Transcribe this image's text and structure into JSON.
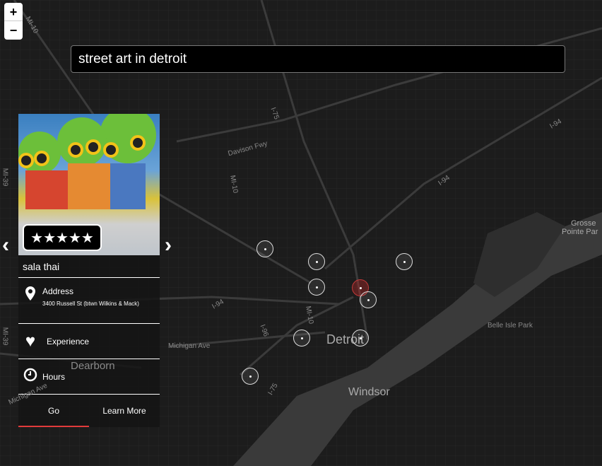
{
  "search": {
    "value": "street art in detroit"
  },
  "zoom": {
    "in": "+",
    "out": "−"
  },
  "card": {
    "rating": "★★★★★",
    "name": "sala thai",
    "address_label": "Address",
    "address": "3400 Russell St (btwn Wilkins & Mack)",
    "experience": "Experience",
    "hours": "Hours",
    "go": "Go",
    "learn_more": "Learn More",
    "prev": "‹",
    "next": "›"
  },
  "map": {
    "labels": {
      "detroit": "Detroit",
      "windsor": "Windsor",
      "dearborn": "Dearborn",
      "grosse": "Grosse",
      "pointe": "Pointe Par",
      "belle": "Belle Isle Park",
      "davison": "Davison Fwy",
      "michigan": "Michigan Ave",
      "michigan2": "Michigan Ave",
      "i75a": "I-75",
      "i75b": "I-75",
      "i94a": "I-94",
      "i94b": "I-94",
      "i94c": "I-94",
      "i96": "I-96",
      "mi10a": "MI-10",
      "mi10b": "MI-10",
      "mi10c": "MI-10",
      "mi39": "MI-39",
      "mi39b": "MI-39"
    }
  }
}
